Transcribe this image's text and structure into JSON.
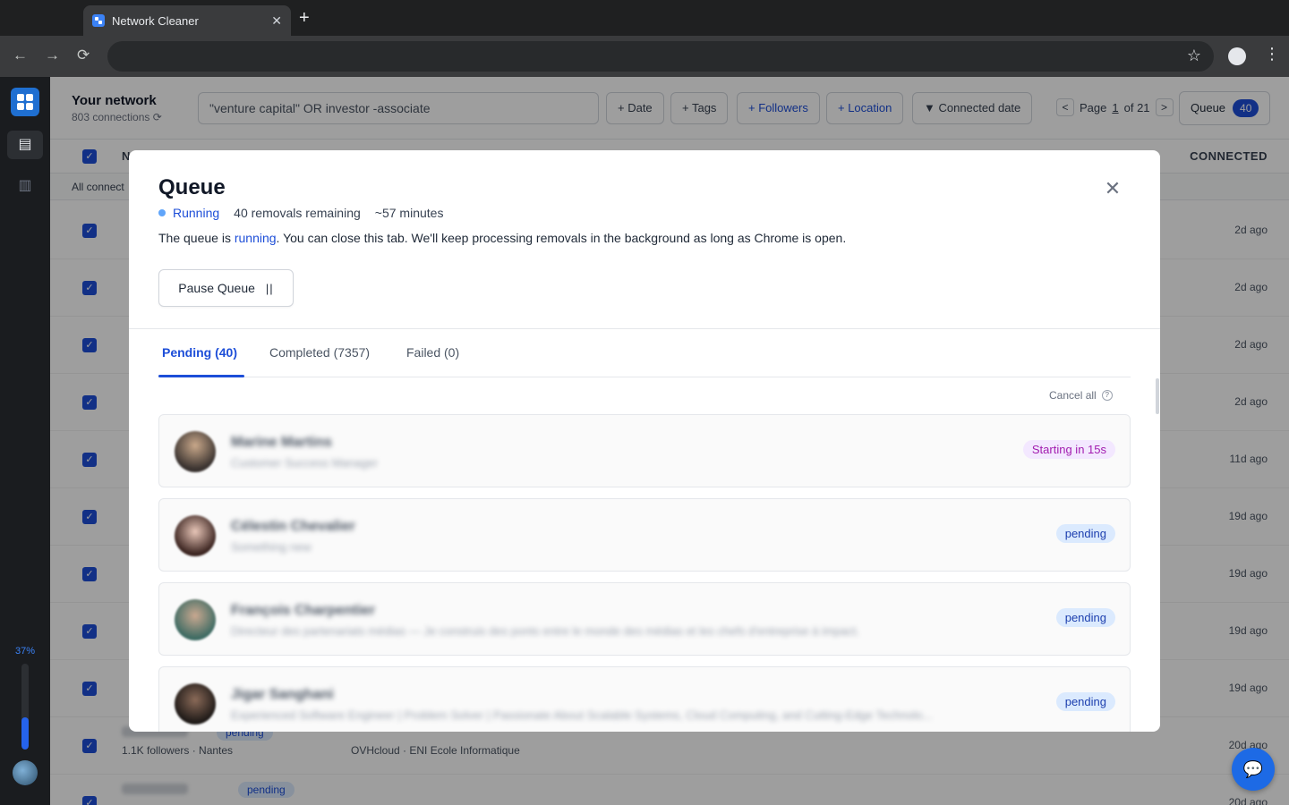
{
  "browser": {
    "tab_title": "Network Cleaner",
    "tab_close": "✕",
    "new_tab": "+",
    "back": "←",
    "forward": "→",
    "reload": "⟳",
    "star": "☆",
    "menu": "⋮"
  },
  "sidebar": {
    "progress_label": "37%",
    "progress_value": 0.37
  },
  "header": {
    "title": "Your network",
    "subtitle": "803 connections",
    "refresh_icon": "⟳",
    "search_value": "\"venture capital\" OR investor -associate",
    "filters": {
      "date": "+ Date",
      "tags": "+ Tags",
      "followers": "+ Followers",
      "location": "+ Location",
      "connected_date": "▼ Connected date"
    },
    "pager": {
      "prev": "<",
      "page_prefix": "Page",
      "page": "1",
      "of_label": "of 21",
      "next": ">"
    },
    "queue_label": "Queue",
    "queue_count": "40"
  },
  "table": {
    "column_name_partial": "N",
    "column_connected": "CONNECTED",
    "all_connections_partial": "All connect",
    "rows_when": [
      "2d ago",
      "2d ago",
      "2d ago",
      "2d ago",
      "11d ago",
      "19d ago",
      "19d ago",
      "19d ago",
      "19d ago",
      "20d ago",
      "20d ago"
    ],
    "row10": {
      "badge": "pending",
      "sub": "1.1K followers · Nantes",
      "sub2": "OVHcloud · ENI Ecole Informatique"
    },
    "row11": {
      "badge": "pending"
    },
    "check": "✓"
  },
  "modal": {
    "title": "Queue",
    "close_icon": "✕",
    "status": "Running",
    "remaining": "40 removals remaining",
    "eta": "~57 minutes",
    "desc_before": "The queue is ",
    "desc_highlight": "running",
    "desc_after": ". You can close this tab. We'll keep processing removals in the background as long as Chrome is open.",
    "pause_label": "Pause Queue",
    "pause_icon": "||",
    "tabs": [
      "Pending (40)",
      "Completed (7357)",
      "Failed (0)"
    ],
    "cancel_all": "Cancel all",
    "help_icon": "?",
    "items": [
      {
        "name": "Marine Martins",
        "subtitle": "Customer Success Manager",
        "badge": "Starting in 15s"
      },
      {
        "name": "Célestin Chevalier",
        "subtitle": "Something new",
        "badge": "pending"
      },
      {
        "name": "François Charpentier",
        "subtitle": "Directeur des partenariats médias — Je construis des ponts entre le monde des médias et les chefs d'entreprise à impact.",
        "badge": "pending"
      },
      {
        "name": "Jigar Sanghani",
        "subtitle": "Experienced Software Engineer | Problem Solver | Passionate About Scalable Systems, Cloud Computing, and Cutting-Edge Technolo...",
        "badge": "pending"
      }
    ]
  },
  "chat_icon": "💬"
}
